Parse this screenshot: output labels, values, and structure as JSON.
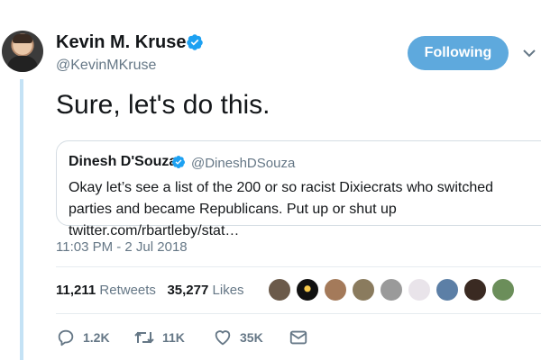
{
  "author": {
    "name": "Kevin M. Kruse",
    "handle": "@KevinMKruse",
    "verified": true
  },
  "follow_button": {
    "label": "Following"
  },
  "tweet": {
    "text": "Sure, let's do this."
  },
  "quoted_tweet": {
    "name": "Dinesh D'Souza",
    "handle": "@DineshDSouza",
    "verified": true,
    "text": "Okay let’s see a list of the 200 or so racist Dixiecrats who switched parties and became Republicans. Put up or shut up twitter.com/rbartleby/stat…"
  },
  "timestamp": "11:03 PM - 2 Jul 2018",
  "stats": {
    "retweets_count": "11,211",
    "retweets_label": "Retweets",
    "likes_count": "35,277",
    "likes_label": "Likes"
  },
  "actions": {
    "reply_count": "1.2K",
    "retweet_count": "11K",
    "like_count": "35K"
  },
  "colors": {
    "accent": "#1da1f2",
    "follow_button": "#5ea9dd",
    "secondary_text": "#657786",
    "thread_line": "#c4e2f5"
  },
  "icons": [
    "verified-badge-icon",
    "chevron-down-icon",
    "reply-icon",
    "retweet-icon",
    "heart-icon",
    "direct-message-icon"
  ]
}
